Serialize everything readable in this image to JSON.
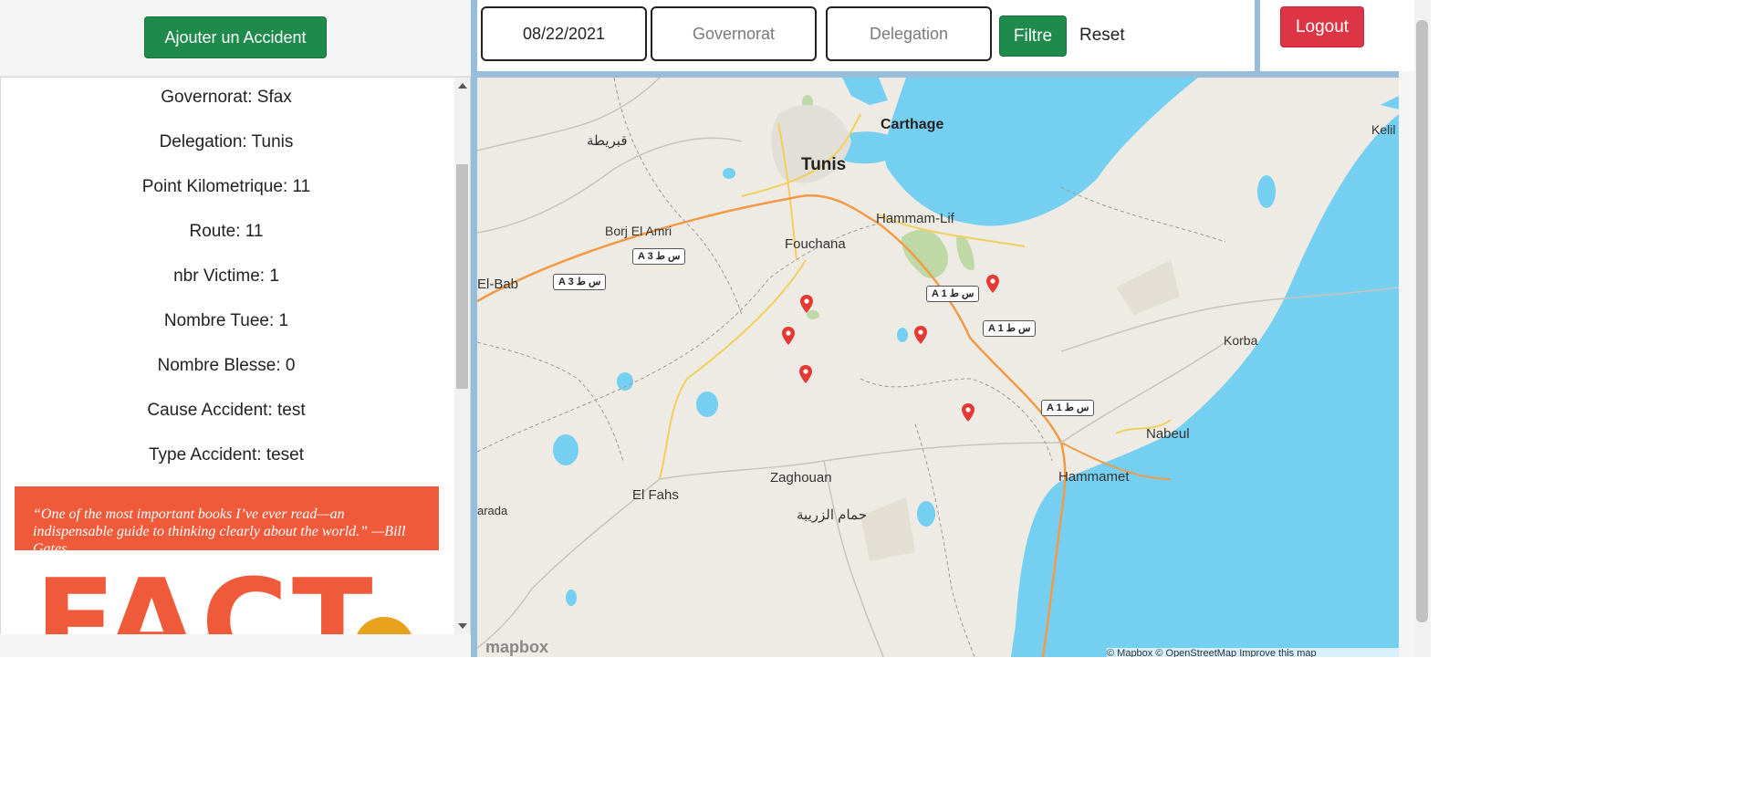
{
  "left": {
    "add_button": "Ajouter un Accident",
    "details": [
      "Governorat: Sfax",
      "Delegation: Tunis",
      "Point Kilometrique: 11",
      "Route: 11",
      "nbr Victime: 1",
      "Nombre Tuee: 1",
      "Nombre Blesse: 0",
      "Cause Accident: test",
      "Type Accident: teset"
    ],
    "book": {
      "quote": "“One of the most important books I’ve ever read—an indispensable guide to thinking clearly about the world.” —Bill Gates",
      "title": "FACT"
    }
  },
  "filter": {
    "date_value": "08/22/2021",
    "governorat_placeholder": "Governorat",
    "delegation_placeholder": "Delegation",
    "filter_button": "Filtre",
    "reset_button": "Reset"
  },
  "logout_button": "Logout",
  "map": {
    "places": [
      "Carthage",
      "Tunis",
      "Hammam-Lif",
      "Fouchana",
      "Borj El Amri",
      "El-Bab",
      "قبريطة",
      "Kelil",
      "Korba",
      "Nabeul",
      "Hammamet",
      "Zaghouan",
      "El Fahs",
      "حمام الزريبة",
      "arada"
    ],
    "roads": [
      "A 3 س ط",
      "A 3 س ط",
      "A 1 س ط",
      "A 1 س ط",
      "A 1 س ط"
    ],
    "marker_count": 6,
    "logo": "mapbox",
    "attribution": "© Mapbox © OpenStreetMap Improve this map"
  },
  "colors": {
    "success": "#1e8a4c",
    "danger": "#dc3545",
    "divider": "#98bddb",
    "water": "#75cff0",
    "land": "#eeebe4"
  }
}
